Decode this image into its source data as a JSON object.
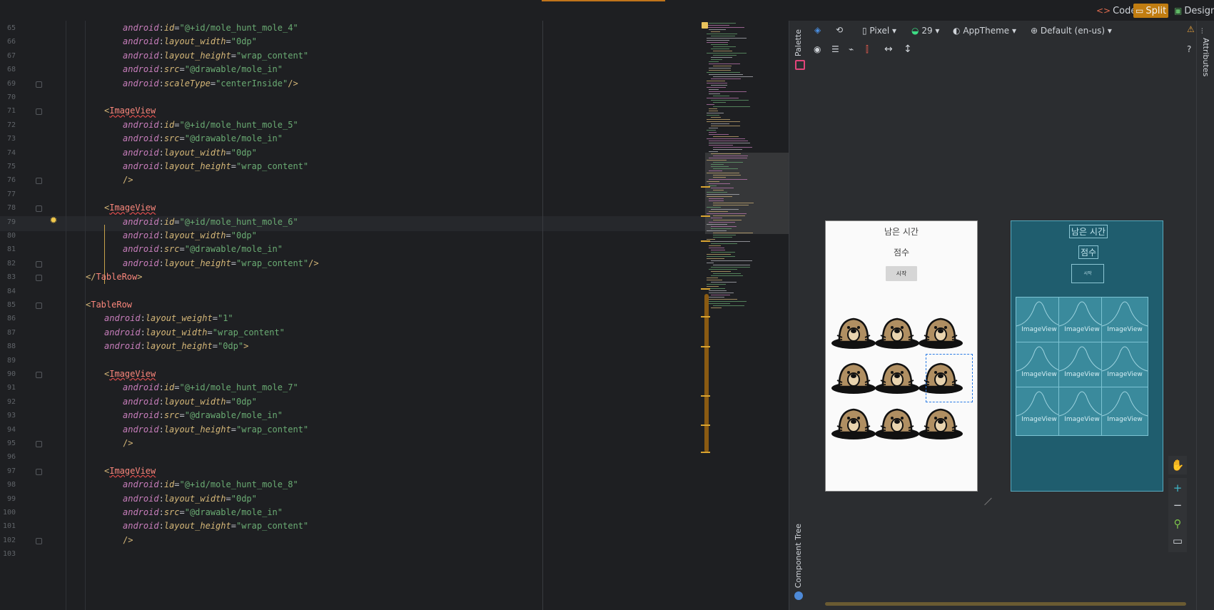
{
  "top": {
    "modes": [
      {
        "label": "Code",
        "icon": "code-icon"
      },
      {
        "label": "Split",
        "icon": "split-icon",
        "active": true
      },
      {
        "label": "Design",
        "icon": "design-icon"
      }
    ]
  },
  "editor": {
    "lines": [
      {
        "n": "65",
        "indent": 6,
        "parts": [
          [
            "ns",
            "android"
          ],
          [
            "p",
            ":"
          ],
          [
            "attr",
            "id"
          ],
          [
            "p",
            "="
          ],
          [
            "str",
            "\"@+id/mole_hunt_mole_4\""
          ]
        ]
      },
      {
        "n": "66",
        "indent": 6,
        "parts": [
          [
            "ns",
            "android"
          ],
          [
            "p",
            ":"
          ],
          [
            "attr",
            "layout_width"
          ],
          [
            "p",
            "="
          ],
          [
            "str",
            "\"0dp\""
          ]
        ]
      },
      {
        "n": "67",
        "indent": 6,
        "parts": [
          [
            "ns",
            "android"
          ],
          [
            "p",
            ":"
          ],
          [
            "attr",
            "layout_height"
          ],
          [
            "p",
            "="
          ],
          [
            "str",
            "\"wrap_content\""
          ]
        ]
      },
      {
        "n": "68",
        "indent": 6,
        "parts": [
          [
            "ns",
            "android"
          ],
          [
            "p",
            ":"
          ],
          [
            "attr",
            "src"
          ],
          [
            "p",
            "="
          ],
          [
            "str",
            "\"@drawable/mole_in\""
          ]
        ]
      },
      {
        "n": "69",
        "indent": 6,
        "parts": [
          [
            "ns",
            "android"
          ],
          [
            "p",
            ":"
          ],
          [
            "attr",
            "scaleType"
          ],
          [
            "p",
            "="
          ],
          [
            "str",
            "\"centerInside\""
          ],
          [
            "tag",
            "/>"
          ]
        ]
      },
      {
        "n": "70",
        "indent": 0,
        "parts": []
      },
      {
        "n": "71",
        "indent": 5,
        "parts": [
          [
            "tag",
            "<"
          ],
          [
            "tagname",
            "ImageView"
          ]
        ]
      },
      {
        "n": "72",
        "indent": 6,
        "parts": [
          [
            "ns",
            "android"
          ],
          [
            "p",
            ":"
          ],
          [
            "attr",
            "id"
          ],
          [
            "p",
            "="
          ],
          [
            "str",
            "\"@+id/mole_hunt_mole_5\""
          ]
        ]
      },
      {
        "n": "73",
        "indent": 6,
        "parts": [
          [
            "ns",
            "android"
          ],
          [
            "p",
            ":"
          ],
          [
            "attr",
            "src"
          ],
          [
            "p",
            "="
          ],
          [
            "str",
            "\"@drawable/mole_in\""
          ]
        ]
      },
      {
        "n": "74",
        "indent": 6,
        "parts": [
          [
            "ns",
            "android"
          ],
          [
            "p",
            ":"
          ],
          [
            "attr",
            "layout_width"
          ],
          [
            "p",
            "="
          ],
          [
            "str",
            "\"0dp\""
          ]
        ]
      },
      {
        "n": "75",
        "indent": 6,
        "parts": [
          [
            "ns",
            "android"
          ],
          [
            "p",
            ":"
          ],
          [
            "attr",
            "layout_height"
          ],
          [
            "p",
            "="
          ],
          [
            "str",
            "\"wrap_content\""
          ]
        ]
      },
      {
        "n": "76",
        "indent": 6,
        "parts": [
          [
            "tag",
            "/>"
          ]
        ]
      },
      {
        "n": "77",
        "indent": 0,
        "parts": []
      },
      {
        "n": "78",
        "indent": 5,
        "parts": [
          [
            "tag",
            "<"
          ],
          [
            "tagname",
            "ImageView"
          ]
        ]
      },
      {
        "n": "79",
        "indent": 6,
        "parts": [
          [
            "ns",
            "android"
          ],
          [
            "p",
            ":"
          ],
          [
            "attr",
            "id"
          ],
          [
            "p",
            "="
          ],
          [
            "str",
            "\"@+id/mole_hunt_mole_6\""
          ]
        ]
      },
      {
        "n": "80",
        "indent": 6,
        "parts": [
          [
            "ns",
            "android"
          ],
          [
            "p",
            ":"
          ],
          [
            "attr",
            "layout_width"
          ],
          [
            "p",
            "="
          ],
          [
            "str",
            "\"0dp\""
          ]
        ]
      },
      {
        "n": "81",
        "indent": 6,
        "parts": [
          [
            "ns",
            "android"
          ],
          [
            "p",
            ":"
          ],
          [
            "attr",
            "src"
          ],
          [
            "p",
            "="
          ],
          [
            "str",
            "\"@drawable/mole_in\""
          ]
        ]
      },
      {
        "n": "82",
        "indent": 6,
        "parts": [
          [
            "ns",
            "android"
          ],
          [
            "p",
            ":"
          ],
          [
            "attr",
            "layout_height"
          ],
          [
            "p",
            "="
          ],
          [
            "str",
            "\"wrap_content\""
          ],
          [
            "tag",
            "/>"
          ]
        ]
      },
      {
        "n": "83",
        "indent": 4,
        "parts": [
          [
            "tag",
            "</"
          ],
          [
            "tagplain",
            "TableRow"
          ],
          [
            "tag",
            ">"
          ]
        ]
      },
      {
        "n": "84",
        "indent": 0,
        "parts": []
      },
      {
        "n": "85",
        "indent": 4,
        "parts": [
          [
            "tag",
            "<"
          ],
          [
            "tagplain",
            "TableRow"
          ]
        ]
      },
      {
        "n": "86",
        "indent": 5,
        "parts": [
          [
            "ns",
            "android"
          ],
          [
            "p",
            ":"
          ],
          [
            "attr",
            "layout_weight"
          ],
          [
            "p",
            "="
          ],
          [
            "str",
            "\"1\""
          ]
        ]
      },
      {
        "n": "87",
        "indent": 5,
        "parts": [
          [
            "ns",
            "android"
          ],
          [
            "p",
            ":"
          ],
          [
            "attr",
            "layout_width"
          ],
          [
            "p",
            "="
          ],
          [
            "str",
            "\"wrap_content\""
          ]
        ]
      },
      {
        "n": "88",
        "indent": 5,
        "parts": [
          [
            "ns",
            "android"
          ],
          [
            "p",
            ":"
          ],
          [
            "attr",
            "layout_height"
          ],
          [
            "p",
            "="
          ],
          [
            "str",
            "\"0dp\""
          ],
          [
            "tag",
            ">"
          ]
        ]
      },
      {
        "n": "89",
        "indent": 0,
        "parts": []
      },
      {
        "n": "90",
        "indent": 5,
        "parts": [
          [
            "tag",
            "<"
          ],
          [
            "tagname",
            "ImageView"
          ]
        ]
      },
      {
        "n": "91",
        "indent": 6,
        "parts": [
          [
            "ns",
            "android"
          ],
          [
            "p",
            ":"
          ],
          [
            "attr",
            "id"
          ],
          [
            "p",
            "="
          ],
          [
            "str",
            "\"@+id/mole_hunt_mole_7\""
          ]
        ]
      },
      {
        "n": "92",
        "indent": 6,
        "parts": [
          [
            "ns",
            "android"
          ],
          [
            "p",
            ":"
          ],
          [
            "attr",
            "layout_width"
          ],
          [
            "p",
            "="
          ],
          [
            "str",
            "\"0dp\""
          ]
        ]
      },
      {
        "n": "93",
        "indent": 6,
        "parts": [
          [
            "ns",
            "android"
          ],
          [
            "p",
            ":"
          ],
          [
            "attr",
            "src"
          ],
          [
            "p",
            "="
          ],
          [
            "str",
            "\"@drawable/mole_in\""
          ]
        ]
      },
      {
        "n": "94",
        "indent": 6,
        "parts": [
          [
            "ns",
            "android"
          ],
          [
            "p",
            ":"
          ],
          [
            "attr",
            "layout_height"
          ],
          [
            "p",
            "="
          ],
          [
            "str",
            "\"wrap_content\""
          ]
        ]
      },
      {
        "n": "95",
        "indent": 6,
        "parts": [
          [
            "tag",
            "/>"
          ]
        ]
      },
      {
        "n": "96",
        "indent": 0,
        "parts": []
      },
      {
        "n": "97",
        "indent": 5,
        "parts": [
          [
            "tag",
            "<"
          ],
          [
            "tagname",
            "ImageView"
          ]
        ]
      },
      {
        "n": "98",
        "indent": 6,
        "parts": [
          [
            "ns",
            "android"
          ],
          [
            "p",
            ":"
          ],
          [
            "attr",
            "id"
          ],
          [
            "p",
            "="
          ],
          [
            "str",
            "\"@+id/mole_hunt_mole_8\""
          ]
        ]
      },
      {
        "n": "99",
        "indent": 6,
        "parts": [
          [
            "ns",
            "android"
          ],
          [
            "p",
            ":"
          ],
          [
            "attr",
            "layout_width"
          ],
          [
            "p",
            "="
          ],
          [
            "str",
            "\"0dp\""
          ]
        ]
      },
      {
        "n": "100",
        "indent": 6,
        "parts": [
          [
            "ns",
            "android"
          ],
          [
            "p",
            ":"
          ],
          [
            "attr",
            "src"
          ],
          [
            "p",
            "="
          ],
          [
            "str",
            "\"@drawable/mole_in\""
          ]
        ]
      },
      {
        "n": "101",
        "indent": 6,
        "parts": [
          [
            "ns",
            "android"
          ],
          [
            "p",
            ":"
          ],
          [
            "attr",
            "layout_height"
          ],
          [
            "p",
            "="
          ],
          [
            "str",
            "\"wrap_content\""
          ]
        ]
      },
      {
        "n": "102",
        "indent": 6,
        "parts": [
          [
            "tag",
            "/>"
          ]
        ]
      },
      {
        "n": "103",
        "indent": 0,
        "parts": []
      }
    ]
  },
  "palette": {
    "palette_label": "Palette",
    "tree_label": "Component Tree"
  },
  "design_toolbar": {
    "device": "Pixel",
    "api": "29",
    "theme": "AppTheme",
    "locale": "Default (en-us)"
  },
  "preview": {
    "remaining_time": "남은 시간",
    "score": "점수",
    "start": "시작",
    "imageview_label": "ImageView"
  },
  "attributes_label": "Attributes",
  "colors": {
    "accent": "#c17d11",
    "blueprint": "#1f5d6e"
  }
}
